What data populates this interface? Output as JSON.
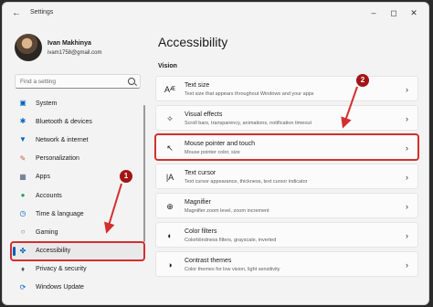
{
  "window": {
    "title": "Settings"
  },
  "profile": {
    "name": "Ivan Makhinya",
    "email": "ivam1758@gmail.com"
  },
  "search": {
    "placeholder": "Find a setting"
  },
  "nav": [
    {
      "label": "System",
      "icon": "monitor-icon"
    },
    {
      "label": "Bluetooth & devices",
      "icon": "bluetooth-icon"
    },
    {
      "label": "Network & internet",
      "icon": "wifi-icon"
    },
    {
      "label": "Personalization",
      "icon": "brush-icon"
    },
    {
      "label": "Apps",
      "icon": "apps-icon"
    },
    {
      "label": "Accounts",
      "icon": "person-icon"
    },
    {
      "label": "Time & language",
      "icon": "globe-clock-icon"
    },
    {
      "label": "Gaming",
      "icon": "gamepad-icon"
    },
    {
      "label": "Accessibility",
      "icon": "accessibility-icon",
      "active": true
    },
    {
      "label": "Privacy & security",
      "icon": "shield-icon"
    },
    {
      "label": "Windows Update",
      "icon": "update-icon"
    }
  ],
  "page": {
    "title": "Accessibility",
    "section": "Vision"
  },
  "cards": [
    {
      "title": "Text size",
      "subtitle": "Text size that appears throughout Windows and your apps",
      "icon": "text-size-icon"
    },
    {
      "title": "Visual effects",
      "subtitle": "Scroll bars, transparency, animations, notification timeout",
      "icon": "sparkle-icon"
    },
    {
      "title": "Mouse pointer and touch",
      "subtitle": "Mouse pointer color, size",
      "icon": "mouse-pointer-icon",
      "highlight": true
    },
    {
      "title": "Text cursor",
      "subtitle": "Text cursor appearance, thickness, text cursor indicator",
      "icon": "text-cursor-icon"
    },
    {
      "title": "Magnifier",
      "subtitle": "Magnifier zoom level, zoom increment",
      "icon": "magnifier-icon"
    },
    {
      "title": "Color filters",
      "subtitle": "Colorblindness filters, grayscale, inverted",
      "icon": "color-filter-icon"
    },
    {
      "title": "Contrast themes",
      "subtitle": "Color themes for low vision, light sensitivity",
      "icon": "contrast-icon"
    }
  ],
  "annotations": {
    "step1": "1",
    "step2": "2"
  },
  "colors": {
    "annotation": "#d32f2f",
    "accent": "#005fb8",
    "badge": "#a31515"
  }
}
